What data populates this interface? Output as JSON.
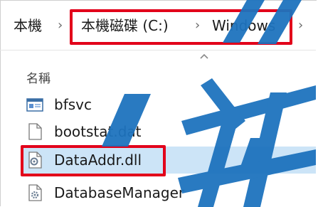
{
  "address_bar": {
    "crumbs": [
      "本機",
      "本機磁碟 (C:)",
      "Windows"
    ],
    "separator": "›"
  },
  "file_list": {
    "column_name": "名稱",
    "sort_indicator": "ascending",
    "items": [
      {
        "name": "bfsvc",
        "icon": "application-icon",
        "selected": false
      },
      {
        "name": "bootstat.dat",
        "icon": "file-icon",
        "selected": false
      },
      {
        "name": "DataAddr.dll",
        "icon": "dll-gear-icon",
        "selected": true
      },
      {
        "name": "DatabaseManager",
        "icon": "settings-file-icon",
        "selected": false
      }
    ]
  },
  "colors": {
    "highlight_box": "#e2001a",
    "selection": "#cce4f7",
    "watermark": "#1e73be"
  }
}
